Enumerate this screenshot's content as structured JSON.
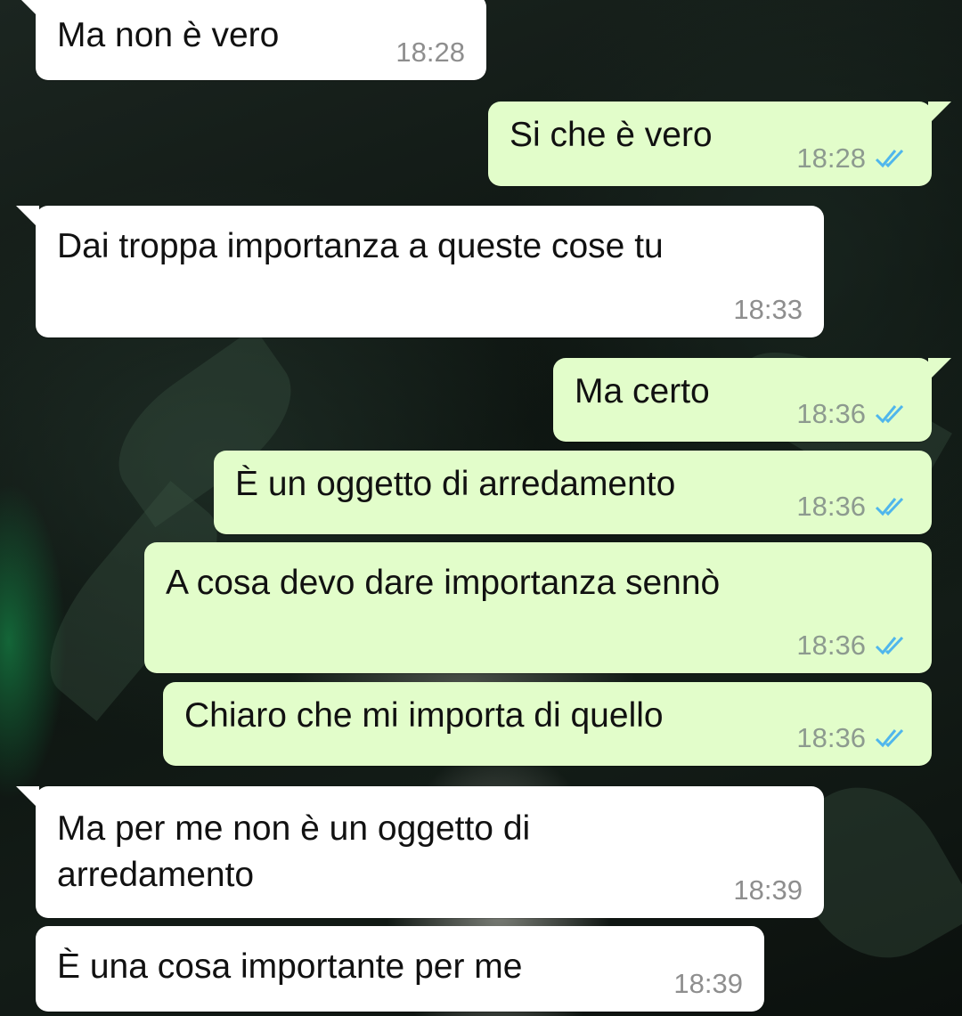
{
  "chat": {
    "messages": [
      {
        "direction": "in",
        "text": "Ma non è vero",
        "time": "18:28"
      },
      {
        "direction": "out",
        "text": "Si che è vero",
        "time": "18:28",
        "status": "read-double-check-icon"
      },
      {
        "direction": "in",
        "text": "Dai troppa importanza a queste cose tu",
        "time": "18:33"
      },
      {
        "direction": "out",
        "text": "Ma certo",
        "time": "18:36",
        "status": "read-double-check-icon"
      },
      {
        "direction": "out",
        "text": "È un oggetto di arredamento",
        "time": "18:36",
        "status": "read-double-check-icon"
      },
      {
        "direction": "out",
        "text": "A cosa devo dare importanza sennò",
        "time": "18:36",
        "status": "read-double-check-icon"
      },
      {
        "direction": "out",
        "text": "Chiaro che mi importa di quello",
        "time": "18:36",
        "status": "read-double-check-icon"
      },
      {
        "direction": "in",
        "text": "Ma per me non è un oggetto di\narredamento",
        "time": "18:39"
      },
      {
        "direction": "in",
        "text": "È una cosa importante per me",
        "time": "18:39"
      }
    ]
  },
  "colors": {
    "incoming_bubble": "#ffffff",
    "outgoing_bubble": "#e2fdca",
    "read_tick": "#4fb6ec",
    "timestamp": "#8e8e8e"
  }
}
